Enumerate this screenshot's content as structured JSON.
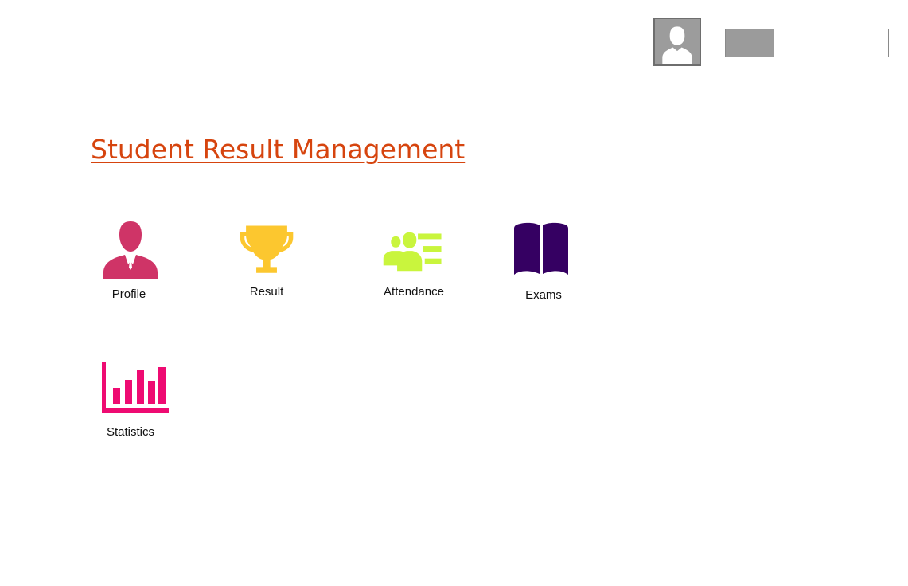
{
  "header": {
    "login_progress_fraction": 0.3
  },
  "page": {
    "title": "Student Result Management"
  },
  "menu": {
    "profile": {
      "label": "Profile",
      "icon": "user-icon"
    },
    "result": {
      "label": "Result",
      "icon": "trophy-icon"
    },
    "attendance": {
      "label": "Attendance",
      "icon": "attendance-icon"
    },
    "exams": {
      "label": "Exams",
      "icon": "book-icon"
    },
    "statistics": {
      "label": "Statistics",
      "icon": "bar-chart-icon"
    }
  },
  "colors": {
    "title": "#d6440e",
    "profile_icon": "#cf3467",
    "result_icon": "#fcc72f",
    "attendance_icon": "#c9f53d",
    "exams_icon": "#350062",
    "statistics_icon": "#ee0b72"
  }
}
